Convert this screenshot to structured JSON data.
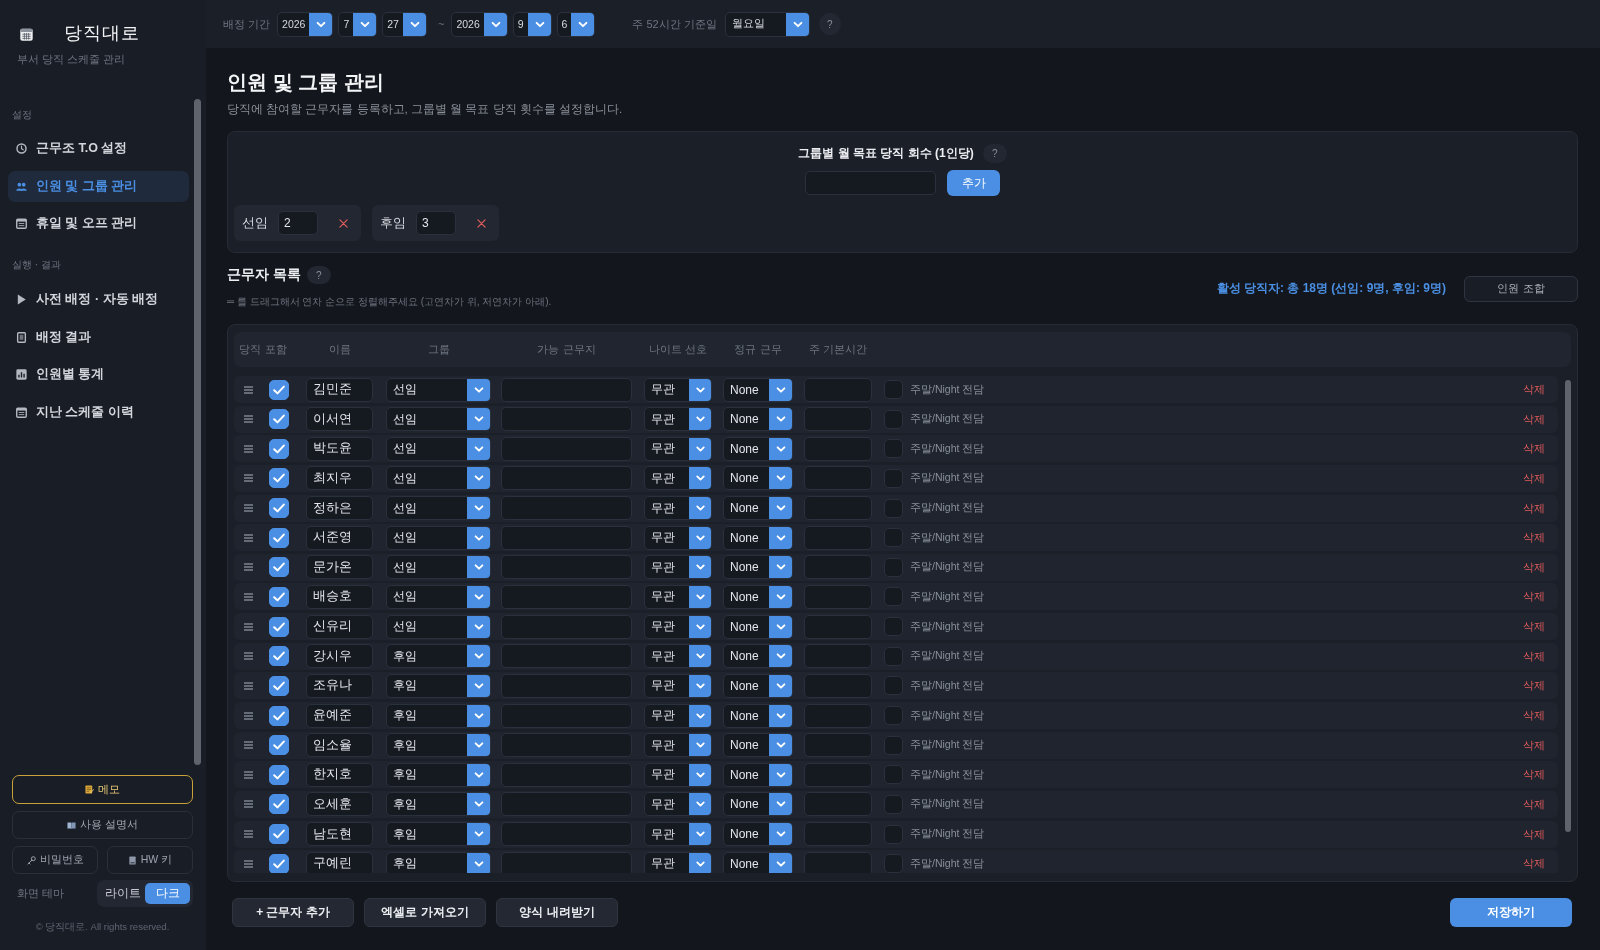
{
  "sidebar": {
    "title": "당직대로",
    "subtitle": "부서 당직 스케줄 관리",
    "sections": [
      {
        "heading": "설정",
        "items": [
          {
            "label": "근무조 T.O 설정",
            "selected": false
          },
          {
            "label": "인원 및 그룹 관리",
            "selected": true
          },
          {
            "label": "휴일 및 오프 관리",
            "selected": false
          }
        ]
      },
      {
        "heading": "실행 · 결과",
        "items": [
          {
            "label": "사전 배정 · 자동 배정",
            "selected": false
          },
          {
            "label": "배정 결과",
            "selected": false
          },
          {
            "label": "인원별 통계",
            "selected": false
          },
          {
            "label": "지난 스케줄 이력",
            "selected": false
          }
        ]
      }
    ],
    "memo_button": "메모",
    "manual_button": "사용 설명서",
    "password_button": "비밀번호",
    "hw_key_button": "HW 키",
    "theme": {
      "label": "화면 테마",
      "options": [
        {
          "label": "라이트",
          "selected": false
        },
        {
          "label": "다크",
          "selected": true
        }
      ]
    },
    "copyright": "© 당직대로. All rights reserved."
  },
  "top_bar": {
    "period_label": "배정 기간",
    "start": {
      "year": "2026",
      "month": "7",
      "day": "27"
    },
    "range_separator": "~",
    "end": {
      "year": "2026",
      "month": "9",
      "day": "6"
    },
    "week_basis_label": "주 52시간 기준일",
    "week_basis": "월요일",
    "help": "?"
  },
  "page": {
    "title": "인원 및 그룹 관리",
    "description": "당직에 참여할 근무자를 등록하고, 그룹별 월 목표 당직 횟수를 설정합니다."
  },
  "group_targets": {
    "title": "그룹별 월 목표 당직 회수 (1인당)",
    "help": "?",
    "add_button": "추가",
    "groups": [
      {
        "name": "선임",
        "target": "2"
      },
      {
        "name": "후임",
        "target": "3"
      }
    ]
  },
  "workers": {
    "title": "근무자 목록",
    "help": "?",
    "hint": "═ 를 드래그해서 연차 순으로 정렬해주세요 (고연차가 위, 저연차가 아래).",
    "summary": "활성 당직자: 총 18명 (선임: 9명, 후임: 9명)",
    "combination_button": "인원 조합",
    "columns": [
      "당직 포함",
      "이름",
      "그룹",
      "가능 근무지",
      "나이트 선호",
      "정규 근무",
      "주 기본시간"
    ],
    "rows": [
      {
        "name": "김민준",
        "included": true,
        "group": "선임",
        "night_preference": "무관",
        "regular_work": "None",
        "weekend_night_only": false,
        "weekend_night_label": "주말/Night 전담",
        "delete_label": "삭제"
      },
      {
        "name": "이서연",
        "included": true,
        "group": "선임",
        "night_preference": "무관",
        "regular_work": "None",
        "weekend_night_only": false,
        "weekend_night_label": "주말/Night 전담",
        "delete_label": "삭제"
      },
      {
        "name": "박도윤",
        "included": true,
        "group": "선임",
        "night_preference": "무관",
        "regular_work": "None",
        "weekend_night_only": false,
        "weekend_night_label": "주말/Night 전담",
        "delete_label": "삭제"
      },
      {
        "name": "최지우",
        "included": true,
        "group": "선임",
        "night_preference": "무관",
        "regular_work": "None",
        "weekend_night_only": false,
        "weekend_night_label": "주말/Night 전담",
        "delete_label": "삭제"
      },
      {
        "name": "정하은",
        "included": true,
        "group": "선임",
        "night_preference": "무관",
        "regular_work": "None",
        "weekend_night_only": false,
        "weekend_night_label": "주말/Night 전담",
        "delete_label": "삭제"
      },
      {
        "name": "서준영",
        "included": true,
        "group": "선임",
        "night_preference": "무관",
        "regular_work": "None",
        "weekend_night_only": false,
        "weekend_night_label": "주말/Night 전담",
        "delete_label": "삭제"
      },
      {
        "name": "문가온",
        "included": true,
        "group": "선임",
        "night_preference": "무관",
        "regular_work": "None",
        "weekend_night_only": false,
        "weekend_night_label": "주말/Night 전담",
        "delete_label": "삭제"
      },
      {
        "name": "배승호",
        "included": true,
        "group": "선임",
        "night_preference": "무관",
        "regular_work": "None",
        "weekend_night_only": false,
        "weekend_night_label": "주말/Night 전담",
        "delete_label": "삭제"
      },
      {
        "name": "신유리",
        "included": true,
        "group": "선임",
        "night_preference": "무관",
        "regular_work": "None",
        "weekend_night_only": false,
        "weekend_night_label": "주말/Night 전담",
        "delete_label": "삭제"
      },
      {
        "name": "강시우",
        "included": true,
        "group": "후임",
        "night_preference": "무관",
        "regular_work": "None",
        "weekend_night_only": false,
        "weekend_night_label": "주말/Night 전담",
        "delete_label": "삭제"
      },
      {
        "name": "조유나",
        "included": true,
        "group": "후임",
        "night_preference": "무관",
        "regular_work": "None",
        "weekend_night_only": false,
        "weekend_night_label": "주말/Night 전담",
        "delete_label": "삭제"
      },
      {
        "name": "윤예준",
        "included": true,
        "group": "후임",
        "night_preference": "무관",
        "regular_work": "None",
        "weekend_night_only": false,
        "weekend_night_label": "주말/Night 전담",
        "delete_label": "삭제"
      },
      {
        "name": "임소율",
        "included": true,
        "group": "후임",
        "night_preference": "무관",
        "regular_work": "None",
        "weekend_night_only": false,
        "weekend_night_label": "주말/Night 전담",
        "delete_label": "삭제"
      },
      {
        "name": "한지호",
        "included": true,
        "group": "후임",
        "night_preference": "무관",
        "regular_work": "None",
        "weekend_night_only": false,
        "weekend_night_label": "주말/Night 전담",
        "delete_label": "삭제"
      },
      {
        "name": "오세훈",
        "included": true,
        "group": "후임",
        "night_preference": "무관",
        "regular_work": "None",
        "weekend_night_only": false,
        "weekend_night_label": "주말/Night 전담",
        "delete_label": "삭제"
      },
      {
        "name": "남도현",
        "included": true,
        "group": "후임",
        "night_preference": "무관",
        "regular_work": "None",
        "weekend_night_only": false,
        "weekend_night_label": "주말/Night 전담",
        "delete_label": "삭제"
      },
      {
        "name": "구예린",
        "included": true,
        "group": "후임",
        "night_preference": "무관",
        "regular_work": "None",
        "weekend_night_only": false,
        "weekend_night_label": "주말/Night 전담",
        "delete_label": "삭제"
      }
    ]
  },
  "footer_buttons": {
    "add": "+ 근무자 추가",
    "import": "엑셀로 가져오기",
    "template": "양식 내려받기",
    "save": "저장하기"
  }
}
